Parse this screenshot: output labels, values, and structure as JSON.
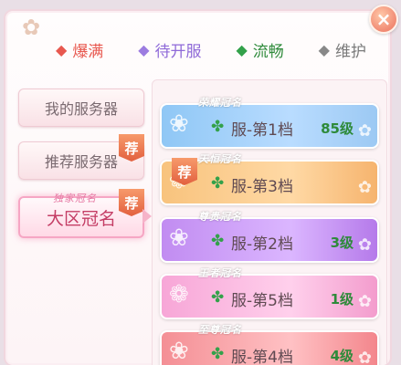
{
  "legend": [
    {
      "label": "爆满",
      "color": "#e8584f",
      "gem": "◆",
      "gem_color": "#e8584f"
    },
    {
      "label": "待开服",
      "color": "#8f6ad8",
      "gem": "◆",
      "gem_color": "#9c7ce0"
    },
    {
      "label": "流畅",
      "color": "#2e8a3a",
      "gem": "◆",
      "gem_color": "#33a14a"
    },
    {
      "label": "维护",
      "color": "#7a7a7a",
      "gem": "◆",
      "gem_color": "#888888"
    }
  ],
  "sidebar": {
    "my_servers": "我的服务器",
    "recommended": "推荐服务器",
    "recommended_badge": "荐",
    "region_crown": "大区冠名",
    "region_crown_badge": "荐",
    "region_crown_title": "独家冠名"
  },
  "servers": [
    {
      "title": "荣耀冠名",
      "name": "服-第1档",
      "level": "85级",
      "status_color": "#33a14a"
    },
    {
      "title": "天恒冠名",
      "name": "服-第3档",
      "level": "",
      "status_color": "#33a14a",
      "badge": "荐"
    },
    {
      "title": "尊贵冠名",
      "name": "服-第2档",
      "level": "3级",
      "status_color": "#33a14a"
    },
    {
      "title": "王者冠名",
      "name": "服-第5档",
      "level": "1级",
      "status_color": "#33a14a"
    },
    {
      "title": "至尊冠名",
      "name": "服-第4档",
      "level": "4级",
      "status_color": "#33a14a"
    }
  ],
  "close_label": "×"
}
